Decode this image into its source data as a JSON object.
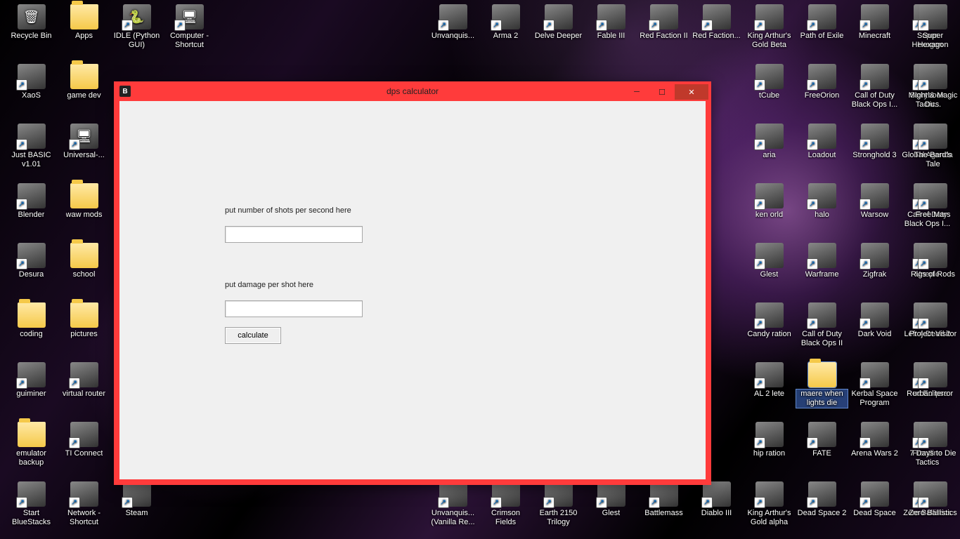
{
  "window": {
    "title": "dps calculator",
    "icon_letter": "B",
    "minimize_glyph": "─",
    "maximize_glyph": "☐",
    "close_glyph": "✕"
  },
  "form": {
    "shots_label": "put number of shots per second here",
    "shots_value": "",
    "damage_label": "put damage per shot here",
    "damage_value": "",
    "calculate_label": "calculate"
  },
  "desktop_grid": {
    "cols": 18,
    "rows": 9,
    "icons": [
      {
        "col": 1,
        "row": 1,
        "label": "Recycle Bin",
        "type": "app",
        "glyph": "🗑"
      },
      {
        "col": 2,
        "row": 1,
        "label": "Apps",
        "type": "folder"
      },
      {
        "col": 3,
        "row": 1,
        "label": "IDLE (Python GUI)",
        "type": "shortcut",
        "glyph": "🐍"
      },
      {
        "col": 4,
        "row": 1,
        "label": "Computer - Shortcut",
        "type": "shortcut",
        "glyph": "🖥"
      },
      {
        "col": 9,
        "row": 1,
        "label": "Unvanquis...",
        "type": "shortcut"
      },
      {
        "col": 10,
        "row": 1,
        "label": "Arma 2",
        "type": "shortcut"
      },
      {
        "col": 11,
        "row": 1,
        "label": "Delve Deeper",
        "type": "shortcut"
      },
      {
        "col": 12,
        "row": 1,
        "label": "Fable III",
        "type": "shortcut"
      },
      {
        "col": 13,
        "row": 1,
        "label": "Red Faction II",
        "type": "shortcut"
      },
      {
        "col": 14,
        "row": 1,
        "label": "Red Faction...",
        "type": "shortcut"
      },
      {
        "col": 15,
        "row": 1,
        "label": "King Arthur's Gold Beta",
        "type": "shortcut"
      },
      {
        "col": 16,
        "row": 1,
        "label": "Path of Exile",
        "type": "shortcut"
      },
      {
        "col": 17,
        "row": 1,
        "label": "Minecraft",
        "type": "shortcut"
      },
      {
        "col": 18,
        "row": 1,
        "label": "Super Hexagon",
        "type": "shortcut"
      },
      {
        "col": 1,
        "row": 2,
        "label": "XaoS",
        "type": "shortcut"
      },
      {
        "col": 2,
        "row": 2,
        "label": "game dev",
        "type": "folder"
      },
      {
        "col": 15,
        "row": 2,
        "label": "tCube",
        "type": "shortcut"
      },
      {
        "col": 16,
        "row": 2,
        "label": "FreeOrion",
        "type": "shortcut"
      },
      {
        "col": 17,
        "row": 2,
        "label": "Call of Duty Black Ops I...",
        "type": "shortcut"
      },
      {
        "col": 18,
        "row": 2,
        "label": "Storybook Tactics",
        "type": "shortcut"
      },
      {
        "col": 18.9,
        "row": 2,
        "label": "Might & Magic Du...",
        "type": "shortcut",
        "hide": true
      },
      {
        "col": 1,
        "row": 3,
        "label": "Just BASIC v1.01",
        "type": "shortcut"
      },
      {
        "col": 2,
        "row": 3,
        "label": "Universal-...",
        "type": "shortcut",
        "glyph": "🖥"
      },
      {
        "col": 15,
        "row": 3,
        "label": "aria",
        "type": "shortcut"
      },
      {
        "col": 16,
        "row": 3,
        "label": "Loadout",
        "type": "shortcut"
      },
      {
        "col": 17,
        "row": 3,
        "label": "Stronghold 3",
        "type": "shortcut"
      },
      {
        "col": 18,
        "row": 3,
        "label": "Global Agenda",
        "type": "shortcut"
      },
      {
        "col": 1,
        "row": 4,
        "label": "Blender",
        "type": "shortcut"
      },
      {
        "col": 2,
        "row": 4,
        "label": "waw mods",
        "type": "folder"
      },
      {
        "col": 15,
        "row": 4,
        "label": "ken orld",
        "type": "shortcut"
      },
      {
        "col": 16,
        "row": 4,
        "label": "halo",
        "type": "shortcut"
      },
      {
        "col": 17,
        "row": 4,
        "label": "Warsow",
        "type": "shortcut"
      },
      {
        "col": 18,
        "row": 4,
        "label": "Call of Duty Black Ops I...",
        "type": "shortcut"
      },
      {
        "col": 1,
        "row": 5,
        "label": "Desura",
        "type": "shortcut"
      },
      {
        "col": 2,
        "row": 5,
        "label": "school",
        "type": "folder"
      },
      {
        "col": 15,
        "row": 5,
        "label": "Glest",
        "type": "shortcut"
      },
      {
        "col": 16,
        "row": 5,
        "label": "Warframe",
        "type": "shortcut"
      },
      {
        "col": 17,
        "row": 5,
        "label": "Zigfrak",
        "type": "shortcut"
      },
      {
        "col": 18,
        "row": 5,
        "label": "Unepic",
        "type": "shortcut"
      },
      {
        "col": 1,
        "row": 6,
        "label": "coding",
        "type": "folder"
      },
      {
        "col": 2,
        "row": 6,
        "label": "pictures",
        "type": "folder"
      },
      {
        "col": 15,
        "row": 6,
        "label": "Candy ration",
        "type": "shortcut"
      },
      {
        "col": 16,
        "row": 6,
        "label": "Call of Duty Black Ops II",
        "type": "shortcut"
      },
      {
        "col": 17,
        "row": 6,
        "label": "Dark Void",
        "type": "shortcut"
      },
      {
        "col": 18,
        "row": 6,
        "label": "Left 4 Dead 2",
        "type": "shortcut"
      },
      {
        "col": 1,
        "row": 7,
        "label": "guiminer",
        "type": "shortcut"
      },
      {
        "col": 2,
        "row": 7,
        "label": "virtual router",
        "type": "shortcut"
      },
      {
        "col": 15,
        "row": 7,
        "label": "AL 2 lete",
        "type": "shortcut"
      },
      {
        "col": 16,
        "row": 7,
        "label": "maere when lights die",
        "type": "folder",
        "selected": true
      },
      {
        "col": 17,
        "row": 7,
        "label": "Kerbal Space Program",
        "type": "shortcut"
      },
      {
        "col": 18,
        "row": 7,
        "label": "Red Eclipse",
        "type": "shortcut"
      },
      {
        "col": 1,
        "row": 8,
        "label": "emulator backup",
        "type": "folder"
      },
      {
        "col": 2,
        "row": 8,
        "label": "TI Connect",
        "type": "shortcut"
      },
      {
        "col": 15,
        "row": 8,
        "label": "hip ration",
        "type": "shortcut"
      },
      {
        "col": 16,
        "row": 8,
        "label": "FATE",
        "type": "shortcut"
      },
      {
        "col": 17,
        "row": 8,
        "label": "Arena Wars 2",
        "type": "shortcut"
      },
      {
        "col": 18,
        "row": 8,
        "label": "Frontline Tactics",
        "type": "shortcut"
      },
      {
        "col": 1,
        "row": 9,
        "label": "Start BlueStacks",
        "type": "shortcut"
      },
      {
        "col": 2,
        "row": 9,
        "label": "Network - Shortcut",
        "type": "shortcut"
      },
      {
        "col": 3,
        "row": 9,
        "label": "Steam",
        "type": "shortcut"
      },
      {
        "col": 9,
        "row": 9,
        "label": "Unvanquis... (Vanilla Re...",
        "type": "shortcut"
      },
      {
        "col": 10,
        "row": 9,
        "label": "Crimson Fields",
        "type": "shortcut"
      },
      {
        "col": 11,
        "row": 9,
        "label": "Earth 2150 Trilogy",
        "type": "shortcut"
      },
      {
        "col": 12,
        "row": 9,
        "label": "Glest",
        "type": "shortcut"
      },
      {
        "col": 13,
        "row": 9,
        "label": "Battlemass",
        "type": "shortcut"
      },
      {
        "col": 14,
        "row": 9,
        "label": "Diablo III",
        "type": "shortcut"
      },
      {
        "col": 15,
        "row": 9,
        "label": "King Arthur's Gold alpha",
        "type": "shortcut"
      },
      {
        "col": 16,
        "row": 9,
        "label": "Dead Space 2",
        "type": "shortcut"
      },
      {
        "col": 17,
        "row": 9,
        "label": "Dead Space",
        "type": "shortcut"
      },
      {
        "col": 18,
        "row": 9,
        "label": "Zero Ballistics",
        "type": "shortcut"
      }
    ],
    "right_edge_extra": [
      {
        "row": 1,
        "label": "Super Hexagon"
      },
      {
        "row": 2,
        "label": "Might & Magic Du..."
      },
      {
        "row": 3,
        "label": "The Bard's Tale"
      },
      {
        "row": 4,
        "label": "Free Mars"
      },
      {
        "row": 5,
        "label": "Rigs of Rods"
      },
      {
        "row": 6,
        "label": "Project Visitor"
      },
      {
        "row": 7,
        "label": "urban terror"
      },
      {
        "row": 8,
        "label": "7 Days to Die"
      },
      {
        "row": 9,
        "label": "Zero Ballistics"
      }
    ]
  }
}
